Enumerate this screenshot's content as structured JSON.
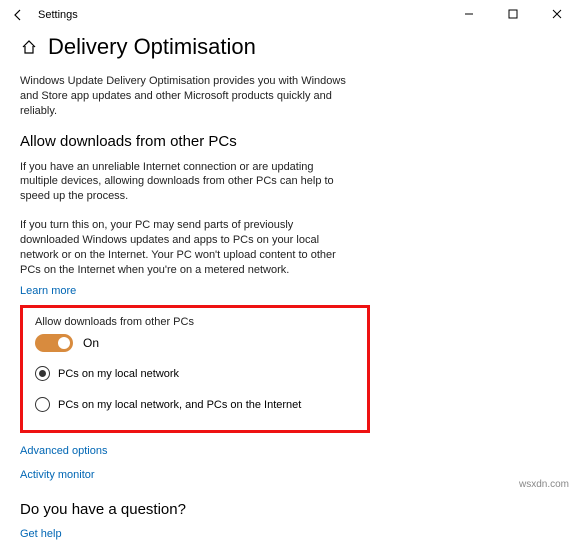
{
  "window": {
    "title": "Settings",
    "minimize": "—",
    "maximize": "□",
    "close": "×"
  },
  "page": {
    "heading": "Delivery Optimisation",
    "intro": "Windows Update Delivery Optimisation provides you with Windows and Store app updates and other Microsoft products quickly and reliably.",
    "section_heading": "Allow downloads from other PCs",
    "para1": "If you have an unreliable Internet connection or are updating multiple devices, allowing downloads from other PCs can help to speed up the process.",
    "para2": "If you turn this on, your PC may send parts of previously downloaded Windows updates and apps to PCs on your local network or on the Internet. Your PC won't upload content to other PCs on the Internet when you're on a metered network.",
    "learn_more": "Learn more",
    "toggle_label": "Allow downloads from other PCs",
    "toggle_state": "On",
    "radio1": "PCs on my local network",
    "radio2": "PCs on my local network, and PCs on the Internet",
    "advanced": "Advanced options",
    "activity": "Activity monitor",
    "question": "Do you have a question?",
    "get_help": "Get help"
  },
  "watermark": "wsxdn.com"
}
